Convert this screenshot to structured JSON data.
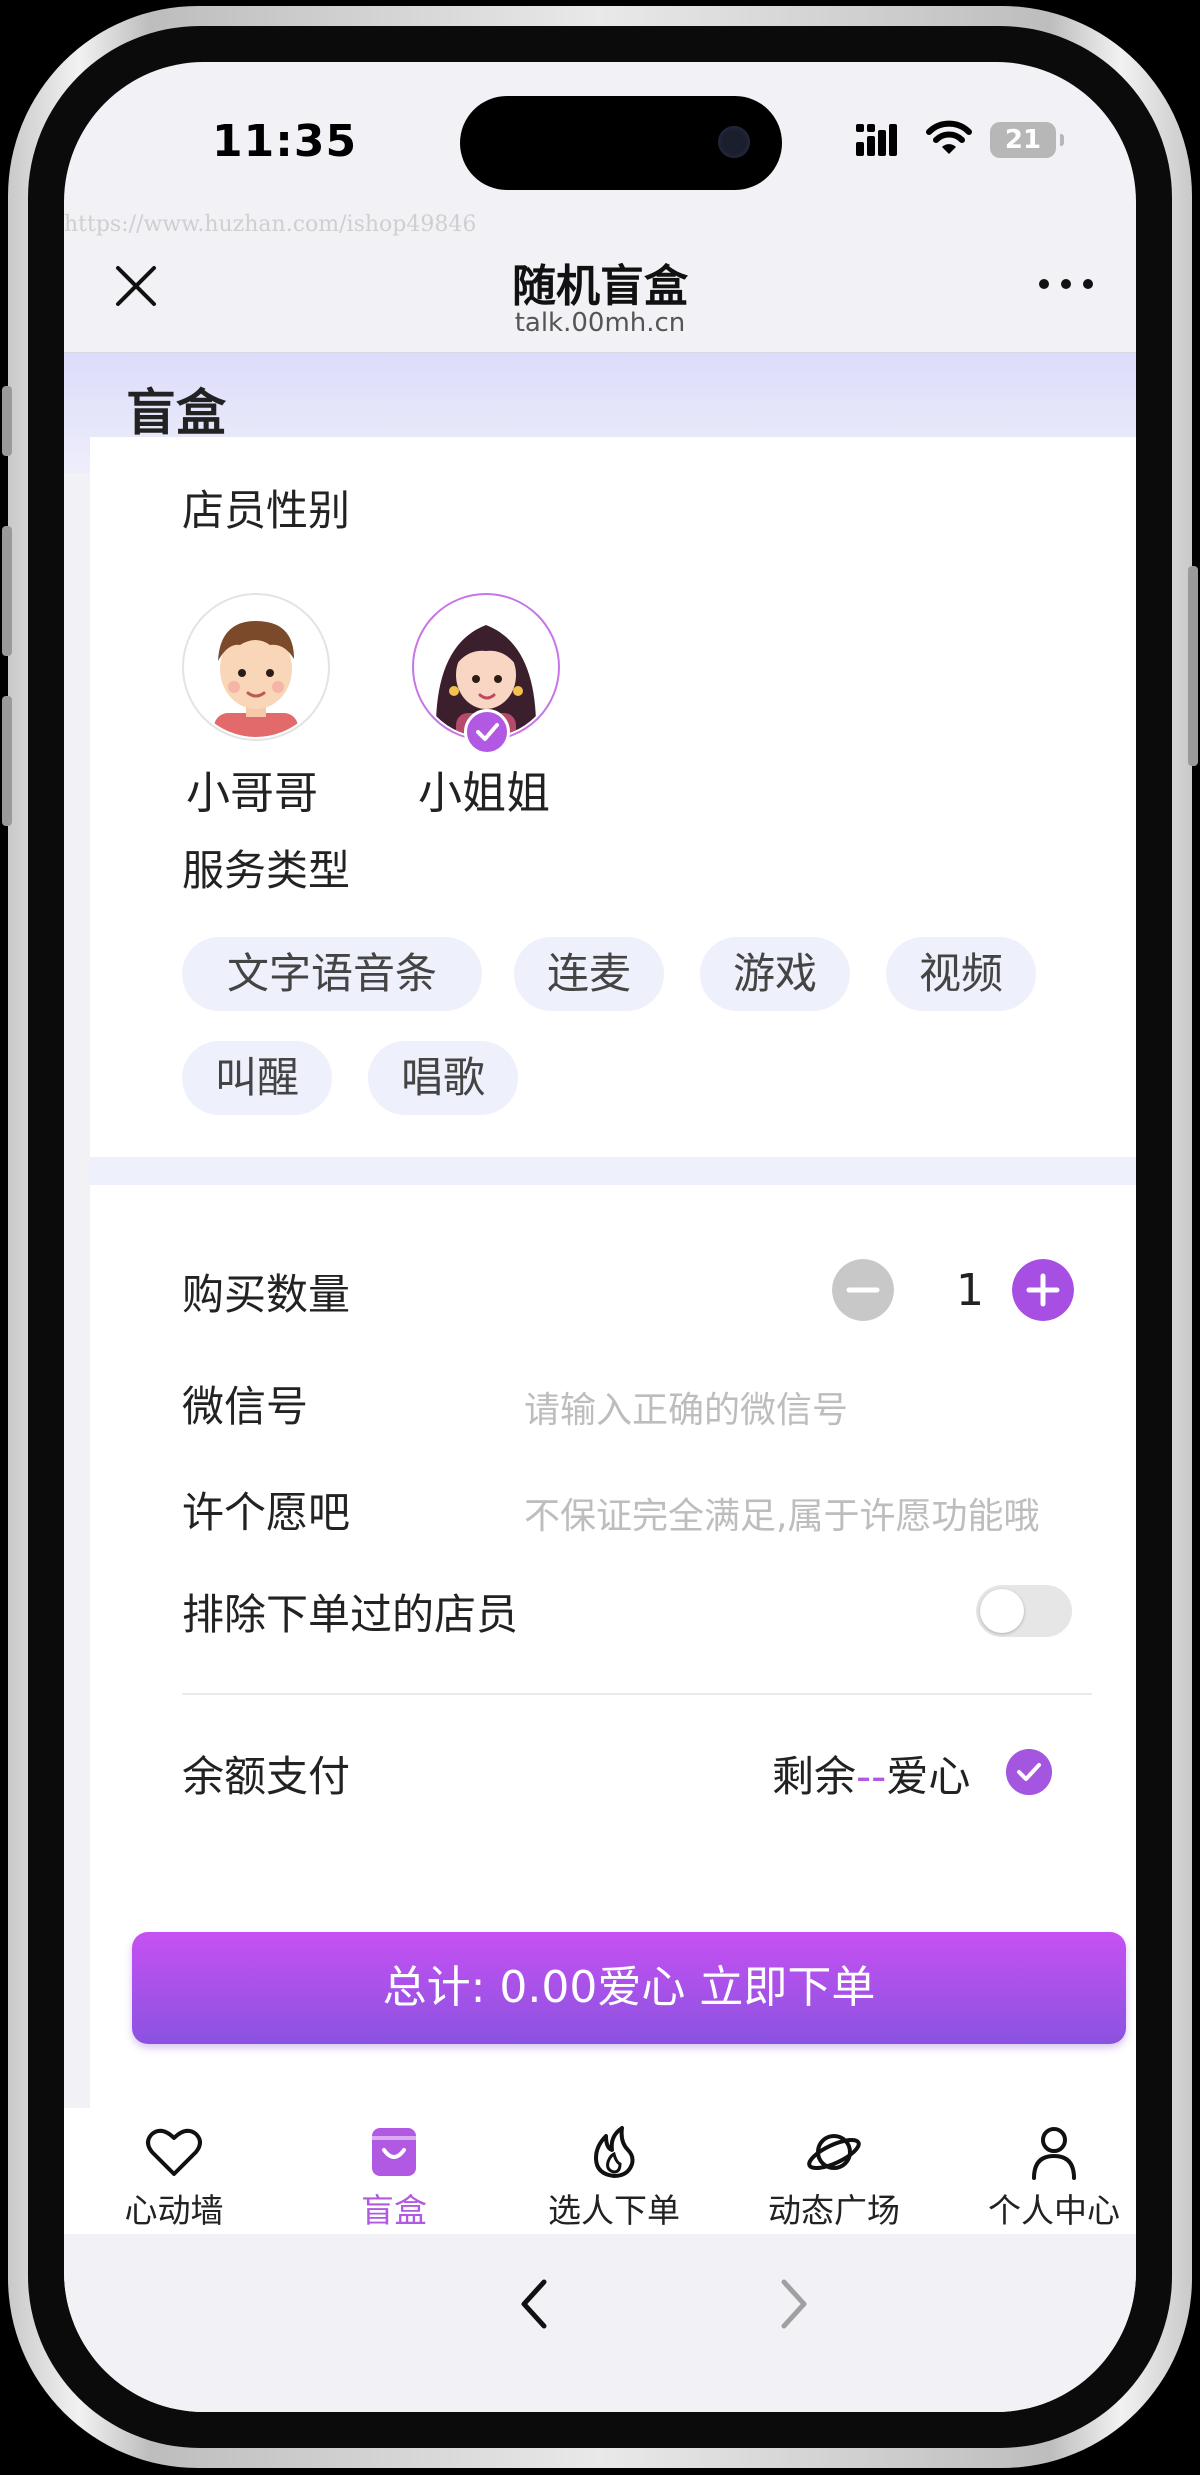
{
  "status": {
    "time": "11:35",
    "battery": "21"
  },
  "watermark": "https://www.huzhan.com/ishop49846",
  "nav": {
    "title": "随机盲盒",
    "subtitle": "talk.00mh.cn"
  },
  "page": {
    "title": "盲盒"
  },
  "gender": {
    "label": "店员性别",
    "options": [
      {
        "name": "小哥哥",
        "selected": false
      },
      {
        "name": "小姐姐",
        "selected": true
      }
    ]
  },
  "service": {
    "label": "服务类型",
    "chips": [
      "文字语音条",
      "连麦",
      "游戏",
      "视频",
      "叫醒",
      "唱歌"
    ]
  },
  "form": {
    "quantity_label": "购买数量",
    "quantity": "1",
    "wechat_label": "微信号",
    "wechat_placeholder": "请输入正确的微信号",
    "wish_label": "许个愿吧",
    "wish_placeholder": "不保证完全满足,属于许愿功能哦",
    "exclude_label": "排除下单过的店员",
    "exclude_on": false,
    "pay_label": "余额支付",
    "balance_prefix": "剩余",
    "balance_dash": "--",
    "balance_unit": "爱心"
  },
  "order_button": "总计: 0.00爱心 立即下单",
  "tabs": [
    {
      "label": "心动墙",
      "icon": "heart-icon",
      "active": false
    },
    {
      "label": "盲盒",
      "icon": "box-icon",
      "active": true
    },
    {
      "label": "选人下单",
      "icon": "flame-icon",
      "active": false
    },
    {
      "label": "动态广场",
      "icon": "planet-icon",
      "active": false
    },
    {
      "label": "个人中心",
      "icon": "user-icon",
      "active": false
    }
  ],
  "colors": {
    "accent": "#b259e4",
    "chip_bg": "#eef0fb",
    "header_bg": "#dcdcfa"
  }
}
